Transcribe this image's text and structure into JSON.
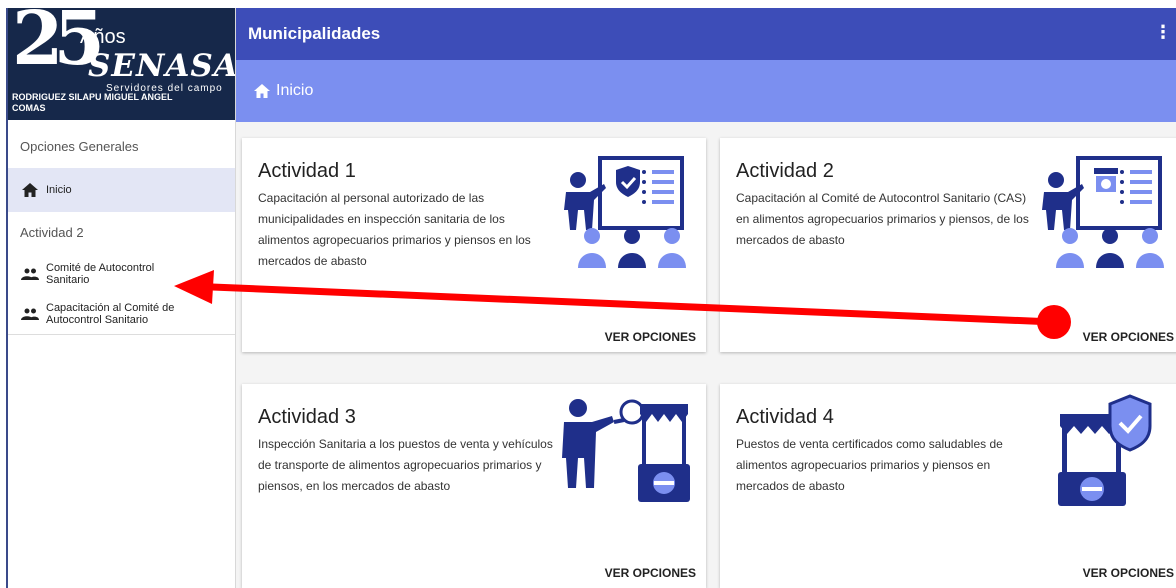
{
  "brand": {
    "number": "25",
    "anos": "Años",
    "name": "SENASA",
    "tagline": "Servidores del campo",
    "user_line1": "RODRIGUEZ SILAPU MIGUEL ANGEL",
    "user_line2": "COMAS"
  },
  "sidebar": {
    "section_general": "Opciones Generales",
    "home_label": "Inicio",
    "section_activity": "Actividad 2",
    "items": [
      {
        "label_line1": "Comité de Autocontrol",
        "label_line2": "Sanitario"
      },
      {
        "label_line1": "Capacitación al Comité de",
        "label_line2": "Autocontrol Sanitario"
      }
    ]
  },
  "header": {
    "title": "Municipalidades",
    "menu_icon": "kebab-menu-icon",
    "breadcrumb": "Inicio"
  },
  "cards": [
    {
      "title": "Actividad 1",
      "description": "Capacitación al personal autorizado de las municipalidades en inspección sanitaria de los alimentos agropecuarios primarios y piensos en los mercados de abasto",
      "button": "VER OPCIONES",
      "icon": "training-presentation-icon"
    },
    {
      "title": "Actividad 2",
      "description": "Capacitación al Comité de Autocontrol Sanitario (CAS) en alimentos agropecuarios primarios y piensos, de los mercados de abasto",
      "button": "VER OPCIONES",
      "icon": "market-training-icon"
    },
    {
      "title": "Actividad 3",
      "description": "Inspección Sanitaria a los puestos de venta y vehículos de transporte de alimentos agropecuarios primarios y piensos, en los mercados de abasto",
      "button": "VER OPCIONES",
      "icon": "inspector-stall-icon"
    },
    {
      "title": "Actividad 4",
      "description": "Puestos de venta certificados como saludables de alimentos agropecuarios primarios y piensos en mercados de abasto",
      "button": "VER OPCIONES",
      "icon": "certified-stall-icon"
    }
  ],
  "colors": {
    "topbar": "#3d4db8",
    "crumbbar": "#7b8ff0",
    "brand_bg": "#16284a",
    "illustration_dark": "#1f2f8a",
    "illustration_light": "#7b8ff0",
    "arrow": "#ff0000"
  }
}
